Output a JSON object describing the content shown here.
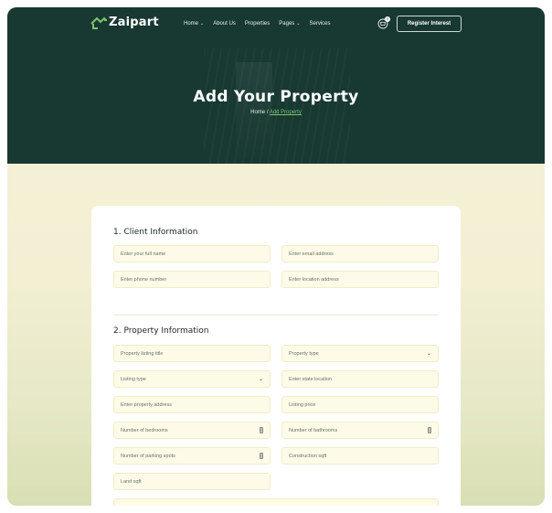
{
  "header": {
    "logo_text": "Zaipart",
    "nav": [
      {
        "label": "Home",
        "dropdown": true
      },
      {
        "label": "About Us",
        "dropdown": false
      },
      {
        "label": "Properties",
        "dropdown": false
      },
      {
        "label": "Pages",
        "dropdown": true
      },
      {
        "label": "Services",
        "dropdown": false
      }
    ],
    "cart_count": "0",
    "register_label": "Register Interest"
  },
  "hero": {
    "title": "Add Your Property",
    "breadcrumb_home": "Home",
    "breadcrumb_separator": " / ",
    "breadcrumb_current": "Add Property"
  },
  "form": {
    "client_title": "1. Client Information",
    "client_fields": {
      "full_name": "Enter your full name",
      "email": "Enter email address",
      "phone": "Enter phone number",
      "location": "Enter location address"
    },
    "property_title": "2. Property Information",
    "property_fields": {
      "listing_title": "Property listing title",
      "property_type": "Property type",
      "listing_type": "Listing type",
      "state_location": "Enter state location",
      "address": "Enter property address",
      "price": "Listing price",
      "bedrooms": "Number of bedrooms",
      "bathrooms": "Number of bathrooms",
      "parking": "Number of parking spots",
      "construction": "Construction sqft",
      "land": "Land sqft"
    }
  },
  "colors": {
    "header_bg": "#183832",
    "accent_green": "#7cc56b",
    "field_bg": "#fdfbe7",
    "page_bg": "#f5f1d8"
  }
}
